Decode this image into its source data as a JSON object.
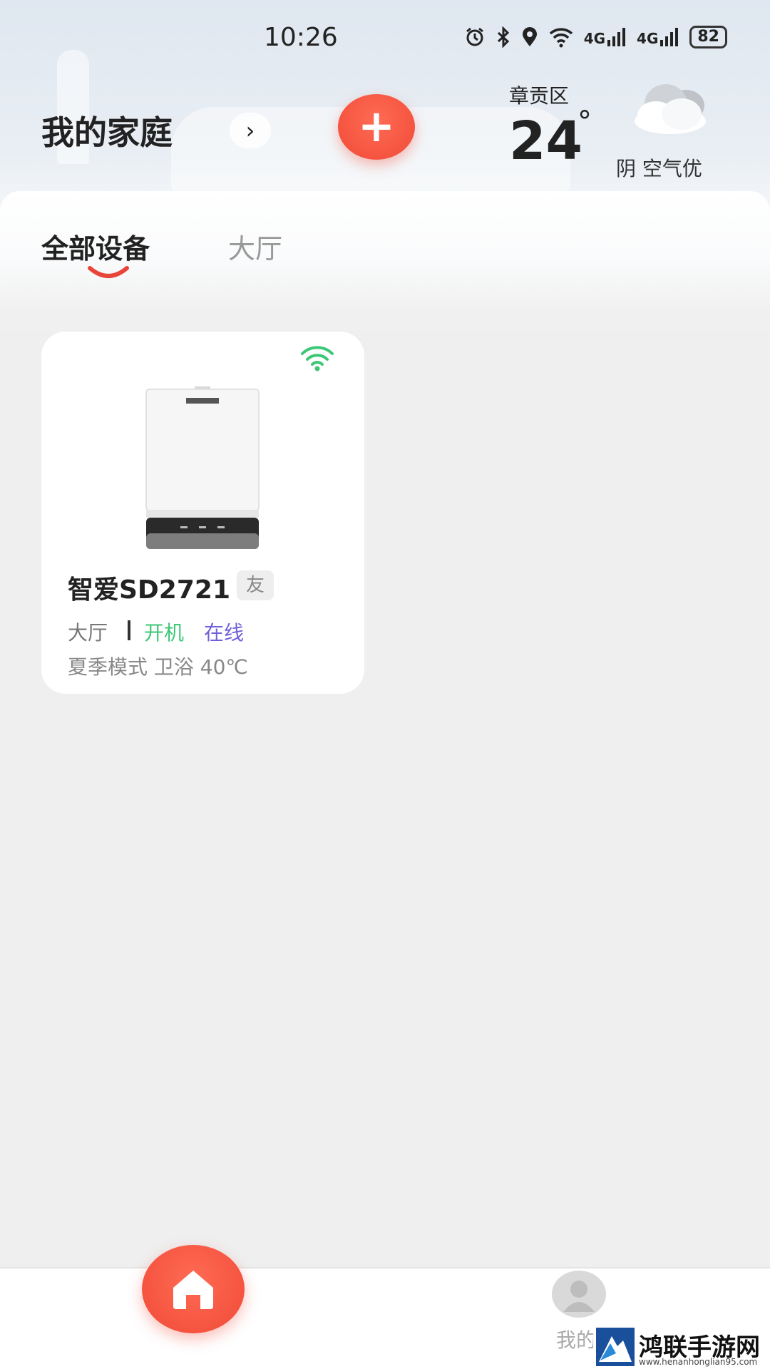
{
  "status_bar": {
    "time": "10:26",
    "icons": [
      "alarm-icon",
      "bluetooth-icon",
      "location-icon",
      "wifi-icon",
      "signal-icon",
      "signal-icon"
    ],
    "signal_label_1": "4G",
    "signal_label_2": "4G",
    "battery": "82"
  },
  "header": {
    "home_title": "我的家庭",
    "chevron": "›",
    "add_symbol": "+",
    "district": "章贡区",
    "temperature": "24",
    "temperature_unit": "°",
    "weather": "阴 空气优",
    "weather_icon": "cloud-icon"
  },
  "tabs": [
    {
      "label": "全部设备",
      "active": true
    },
    {
      "label": "大厅",
      "active": false
    }
  ],
  "device": {
    "name": "智爱SD2721",
    "badge": "友",
    "room": "大厅",
    "power": "开机",
    "online": "在线",
    "mode": "夏季模式  卫浴  40℃",
    "wifi_icon": "wifi-icon",
    "colors": {
      "power": "#3cc776",
      "online": "#6f62d8"
    }
  },
  "bottom_nav": {
    "home_icon": "home-icon",
    "mine_label": "我的"
  },
  "watermark": {
    "title": "鸿联手游网",
    "url": "www.henanhonglian95.com"
  },
  "colors": {
    "accent": "#f04a36",
    "background": "#efefef"
  }
}
